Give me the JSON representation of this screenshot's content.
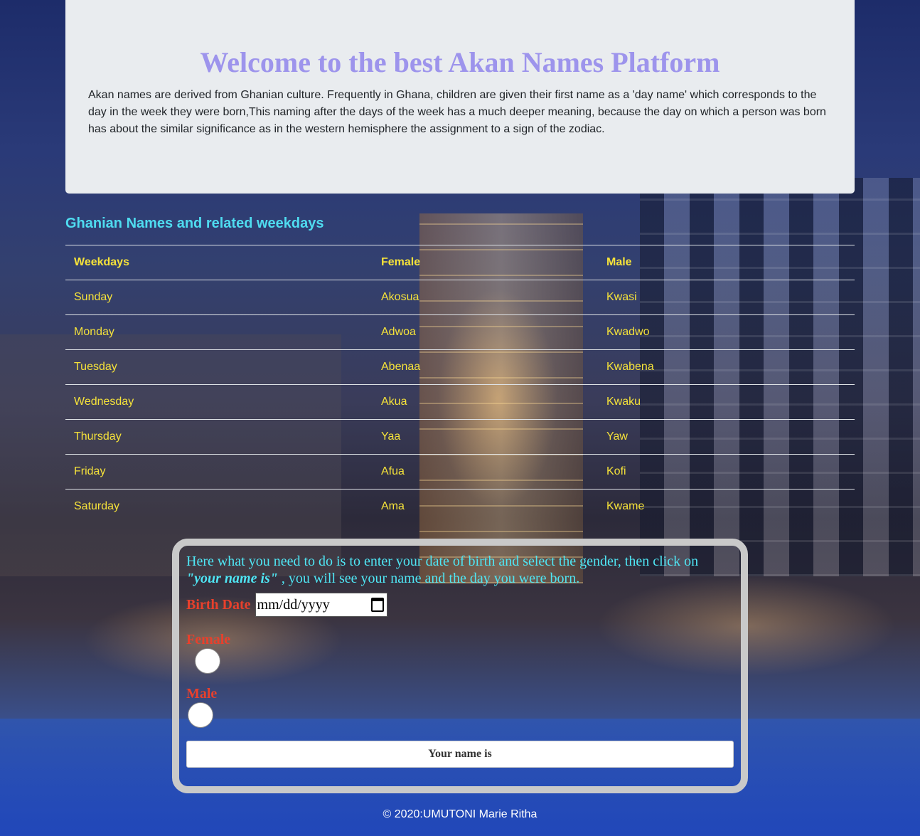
{
  "header": {
    "title": "Welcome to the best Akan Names Platform",
    "description": "Akan names are derived from Ghanian culture. Frequently in Ghana, children are given their first name as a 'day name' which corresponds to the day in the week they were born,This naming after the days of the week has a much deeper meaning, because the day on which a person was born has about the similar significance as in the western hemisphere the assignment to a sign of the zodiac."
  },
  "names_table": {
    "title": "Ghanian Names and related weekdays",
    "columns": [
      "Weekdays",
      "Female",
      "Male"
    ],
    "rows": [
      [
        "Sunday",
        "Akosua",
        "Kwasi"
      ],
      [
        "Monday",
        "Adwoa",
        "Kwadwo"
      ],
      [
        "Tuesday",
        "Abenaa",
        "Kwabena"
      ],
      [
        "Wednesday",
        "Akua",
        "Kwaku"
      ],
      [
        "Thursday",
        "Yaa",
        "Yaw"
      ],
      [
        "Friday",
        "Afua",
        "Kofi"
      ],
      [
        "Saturday",
        "Ama",
        "Kwame"
      ]
    ]
  },
  "form": {
    "instructions_before": "Here what you need to do is to enter your date of birth and select the gender, then click on ",
    "instructions_emphasis": "\"your name is\"",
    "instructions_after": " , you will see your name and the day you were born.",
    "birth_date_label": "Birth Date",
    "birth_date_placeholder": "mm/dd/yyyy",
    "female_label": "Female",
    "male_label": "Male",
    "submit_label": "Your name is"
  },
  "footer": {
    "text": "© 2020:UMUTONI Marie Ritha"
  },
  "colors": {
    "title": "#9d94ec",
    "table_text": "#f5e23a",
    "table_title": "#4fdcf0",
    "instructions": "#4fe6f4",
    "form_labels": "#e8402c",
    "jumbotron_bg": "#e9ecef"
  }
}
